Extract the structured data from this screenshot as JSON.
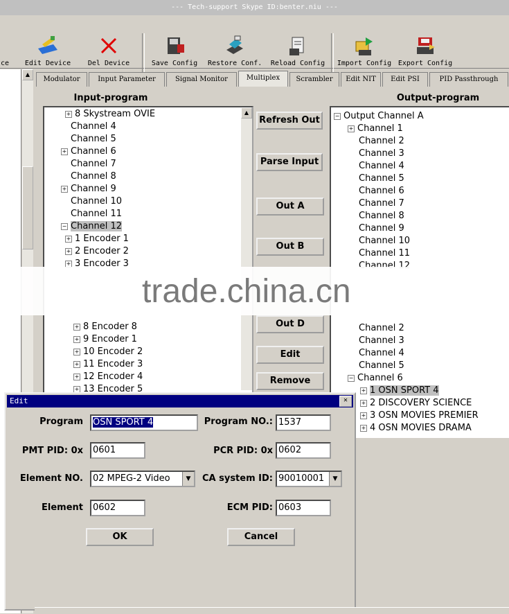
{
  "window": {
    "title": "--- Tech-support Skype ID:benter.niu ---"
  },
  "toolbar": {
    "partial_label": "ce",
    "items": [
      {
        "label": "Edit Device",
        "icon": "edit-device-icon"
      },
      {
        "label": "Del Device",
        "icon": "delete-x-icon"
      },
      {
        "label": "Save Config",
        "icon": "save-config-icon"
      },
      {
        "label": "Restore Conf.",
        "icon": "restore-config-icon"
      },
      {
        "label": "Reload Config",
        "icon": "reload-config-icon"
      },
      {
        "label": "Import Config",
        "icon": "import-config-icon"
      },
      {
        "label": "Export Config",
        "icon": "export-config-icon"
      }
    ]
  },
  "tabs": [
    "Modulator",
    "Input Parameter",
    "Signal Monitor",
    "Multiplex",
    "Scrambler",
    "Edit NIT",
    "Edit PSI",
    "PID Passthrough"
  ],
  "active_tab": "Multiplex",
  "input": {
    "header": "Input-program",
    "rows": [
      {
        "label": "8 Skystream OVIE",
        "indent": 2,
        "exp": true
      },
      {
        "label": "Channel 4",
        "indent": 1,
        "exp": false
      },
      {
        "label": "Channel 5",
        "indent": 1,
        "exp": false
      },
      {
        "label": "Channel 6",
        "indent": 1,
        "exp": true
      },
      {
        "label": "Channel 7",
        "indent": 1,
        "exp": false
      },
      {
        "label": "Channel 8",
        "indent": 1,
        "exp": false
      },
      {
        "label": "Channel 9",
        "indent": 1,
        "exp": true
      },
      {
        "label": "Channel 10",
        "indent": 1,
        "exp": false
      },
      {
        "label": "Channel 11",
        "indent": 1,
        "exp": false
      },
      {
        "label": "Channel 12",
        "indent": 1,
        "exp": true,
        "selected": true,
        "open": true
      },
      {
        "label": "1 Encoder 1",
        "indent": 2,
        "exp": true
      },
      {
        "label": "2 Encoder 2",
        "indent": 2,
        "exp": true
      },
      {
        "label": "3 Encoder 3",
        "indent": 2,
        "exp": true
      }
    ],
    "rows_lower": [
      {
        "label": "8 Encoder 8",
        "indent": 2,
        "exp": true
      },
      {
        "label": "9 Encoder 1",
        "indent": 2,
        "exp": true
      },
      {
        "label": "10 Encoder 2",
        "indent": 2,
        "exp": true
      },
      {
        "label": "11 Encoder 3",
        "indent": 2,
        "exp": true
      },
      {
        "label": "12 Encoder 4",
        "indent": 2,
        "exp": true
      },
      {
        "label": "13 Encoder 5",
        "indent": 2,
        "exp": true
      }
    ]
  },
  "middle_buttons": [
    "Refresh Out",
    "Parse Input",
    "Out A",
    "Out B",
    "Out D",
    "Edit",
    "Remove"
  ],
  "output": {
    "header": "Output-program",
    "root": "Output Channel A",
    "rows": [
      {
        "label": "Channel 1",
        "exp": true
      },
      {
        "label": "Channel 2",
        "exp": false
      },
      {
        "label": "Channel 3",
        "exp": false
      },
      {
        "label": "Channel 4",
        "exp": false
      },
      {
        "label": "Channel 5",
        "exp": false
      },
      {
        "label": "Channel 6",
        "exp": false
      },
      {
        "label": "Channel 7",
        "exp": false
      },
      {
        "label": "Channel 8",
        "exp": false
      },
      {
        "label": "Channel 9",
        "exp": false
      },
      {
        "label": "Channel 10",
        "exp": false
      },
      {
        "label": "Channel 11",
        "exp": false
      },
      {
        "label": "Channel 12",
        "exp": false
      }
    ],
    "rows_lower": [
      {
        "label": "Channel 2",
        "indent": 1,
        "exp": false
      },
      {
        "label": "Channel 3",
        "indent": 1,
        "exp": false
      },
      {
        "label": "Channel 4",
        "indent": 1,
        "exp": false
      },
      {
        "label": "Channel 5",
        "indent": 1,
        "exp": false
      },
      {
        "label": "Channel 6",
        "indent": 1,
        "exp": true,
        "open": true
      },
      {
        "label": "1 OSN SPORT 4",
        "indent": 2,
        "exp": true,
        "selected": true
      },
      {
        "label": "2 DISCOVERY SCIENCE",
        "indent": 2,
        "exp": true
      },
      {
        "label": "3 OSN MOVIES PREMIER",
        "indent": 2,
        "exp": true
      },
      {
        "label": "4 OSN MOVIES DRAMA",
        "indent": 2,
        "exp": true
      }
    ]
  },
  "watermark": "trade.china.cn",
  "dialog": {
    "title": "Edit",
    "close": "✕",
    "program_label": "Program",
    "program_value": "OSN SPORT 4",
    "program_no_label": "Program NO.:",
    "program_no_value": "1537",
    "pmt_label": "PMT PID: 0x",
    "pmt_value": "0601",
    "pcr_label": "PCR PID: 0x",
    "pcr_value": "0602",
    "element_no_label": "Element NO.",
    "element_no_value": "02 MPEG-2 Video",
    "ca_label": "CA system ID:",
    "ca_value": "90010001",
    "element_label": "Element",
    "element_value": "0602",
    "ecm_label": "ECM PID:",
    "ecm_value": "0603",
    "ok_label": "OK",
    "cancel_label": "Cancel"
  }
}
